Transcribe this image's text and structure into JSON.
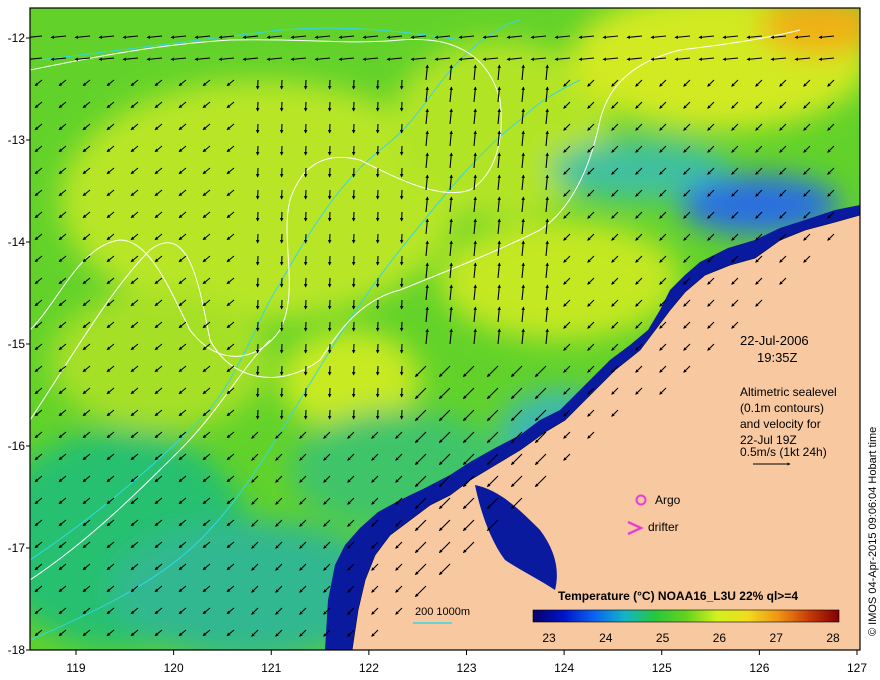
{
  "axes": {
    "x_ticks": [
      "119",
      "120",
      "121",
      "122",
      "123",
      "124",
      "125",
      "126",
      "127"
    ],
    "y_ticks": [
      "-12",
      "-13",
      "-14",
      "-15",
      "-16",
      "-17",
      "-18"
    ]
  },
  "info": {
    "date": "22-Jul-2006",
    "time": "19:35Z",
    "altimetry_lines": [
      "Altimetric sealevel",
      "(0.1m contours)",
      "and velocity for",
      "22-Jul 19Z",
      "0.5m/s (1kt 24h)"
    ]
  },
  "markers": {
    "argo_label": "Argo",
    "drifter_label": "drifter"
  },
  "bathymetry_legend": {
    "label": "200  1000m"
  },
  "colorbar": {
    "title": "Temperature (°C) NOAA16_L3U 22% ql>=4",
    "ticks": [
      "23",
      "24",
      "25",
      "26",
      "27",
      "28"
    ],
    "stops": [
      "#08006a",
      "#0014c8",
      "#0a64f0",
      "#14b4c8",
      "#28c83c",
      "#64d21e",
      "#d2f01e",
      "#f0dc1e",
      "#f09614",
      "#c83c0a",
      "#820000"
    ]
  },
  "credit": "© IMOS 04-Apr-2015 09:06:04 Hobart time",
  "colors": {
    "land": "#f8c9a0",
    "ocean_mid": "#6ad62a",
    "coast_deep": "#0a1a9e",
    "contour": "#ffffff",
    "isobath": "#33d6e8",
    "argo": "#e83cd8",
    "drifter": "#e83cd8"
  }
}
